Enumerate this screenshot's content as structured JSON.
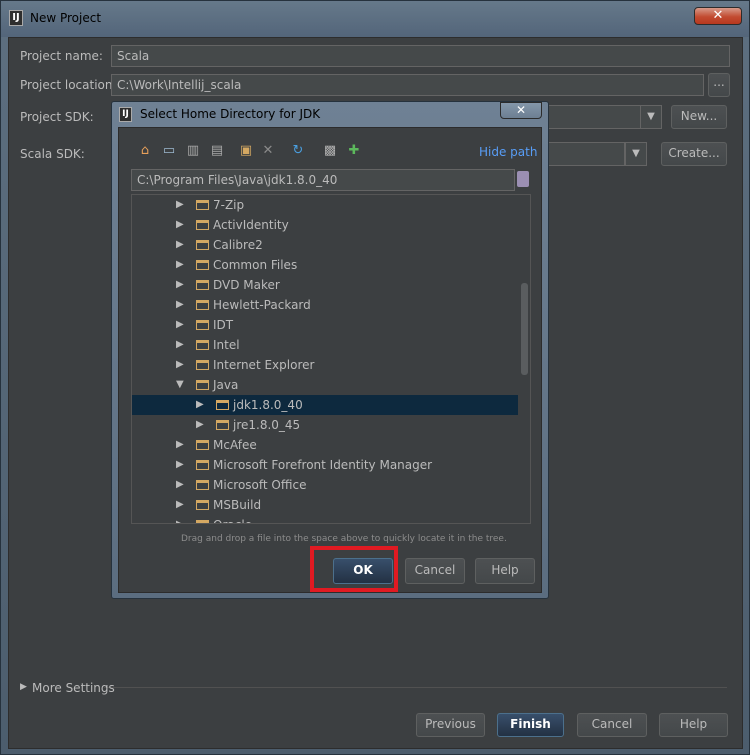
{
  "window": {
    "title": "New Project",
    "close_glyph": "✕",
    "app_icon_text": "IJ"
  },
  "form": {
    "project_name_label": "Project name:",
    "project_name_value": "Scala",
    "project_location_label": "Project location:",
    "project_location_value": "C:\\Work\\Intellij_scala",
    "browse_label": "...",
    "project_sdk_label": "Project SDK:",
    "sdk_new_label": "New...",
    "scala_sdk_label": "Scala SDK:",
    "scala_create_label": "Create...",
    "combo_arrow": "▼"
  },
  "dialog": {
    "title": "Select Home Directory for JDK",
    "close_glyph": "✕",
    "hide_path_label": "Hide path",
    "path_value": "C:\\Program Files\\Java\\jdk1.8.0_40",
    "hint": "Drag and drop a file into the space above to quickly locate it in the tree.",
    "ok_label": "OK",
    "cancel_label": "Cancel",
    "help_label": "Help",
    "toolbar_icons": [
      "home-icon",
      "desktop-icon",
      "project-icon",
      "module-icon",
      "new-folder-icon",
      "delete-icon",
      "refresh-icon",
      "show-hidden-icon",
      "add-icon"
    ],
    "tree": [
      {
        "name": "7-Zip",
        "expanded": false,
        "level": 0
      },
      {
        "name": "ActivIdentity",
        "expanded": false,
        "level": 0
      },
      {
        "name": "Calibre2",
        "expanded": false,
        "level": 0
      },
      {
        "name": "Common Files",
        "expanded": false,
        "level": 0
      },
      {
        "name": "DVD Maker",
        "expanded": false,
        "level": 0
      },
      {
        "name": "Hewlett-Packard",
        "expanded": false,
        "level": 0
      },
      {
        "name": "IDT",
        "expanded": false,
        "level": 0
      },
      {
        "name": "Intel",
        "expanded": false,
        "level": 0
      },
      {
        "name": "Internet Explorer",
        "expanded": false,
        "level": 0
      },
      {
        "name": "Java",
        "expanded": true,
        "level": 0
      },
      {
        "name": "jdk1.8.0_40",
        "expanded": false,
        "level": 1,
        "selected": true
      },
      {
        "name": "jre1.8.0_45",
        "expanded": false,
        "level": 1
      },
      {
        "name": "McAfee",
        "expanded": false,
        "level": 0
      },
      {
        "name": "Microsoft Forefront Identity Manager",
        "expanded": false,
        "level": 0
      },
      {
        "name": "Microsoft Office",
        "expanded": false,
        "level": 0
      },
      {
        "name": "MSBuild",
        "expanded": false,
        "level": 0
      },
      {
        "name": "Oracle",
        "expanded": false,
        "level": 0
      }
    ]
  },
  "footer": {
    "more_settings_label": "More Settings",
    "previous_label": "Previous",
    "finish_label": "Finish",
    "cancel_label": "Cancel",
    "help_label": "Help"
  },
  "colors": {
    "panel_bg": "#3c3f41",
    "selection_bg": "#0d293e",
    "folder": "#d4a862",
    "hide_path_link": "#589df6",
    "highlight_box": "#e01a22"
  }
}
